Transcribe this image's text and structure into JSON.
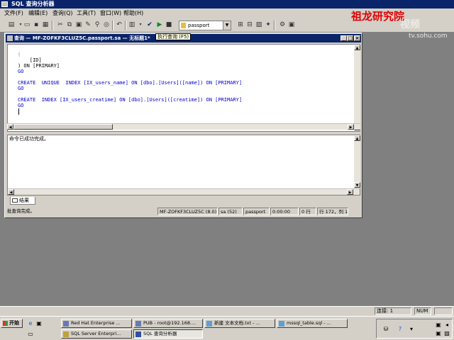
{
  "app": {
    "title": "SQL 查询分析器"
  },
  "watermark": {
    "cn": "祖龙研究院",
    "video": "视频",
    "site": "tv.sohu.com"
  },
  "menu": [
    "文件(F)",
    "编辑(E)",
    "查询(Q)",
    "工具(T)",
    "窗口(W)",
    "帮助(H)"
  ],
  "toolbar": {
    "database": "passport",
    "tooltip": "执行查询 (F5)",
    "icons": [
      "new-query-icon",
      "open-icon",
      "save-icon",
      "load-icon",
      "cut-icon",
      "copy-icon",
      "paste-icon",
      "clear-icon",
      "find-icon",
      "undo-icon",
      "results-mode-icon",
      "parse-icon",
      "execute-icon",
      "stop-icon",
      "object-browser-icon",
      "object-search-icon",
      "plan-icon",
      "options-icon"
    ]
  },
  "query_window": {
    "title": "查询 — MF-ZOFKF3CLUZ5C.passport.sa — 无标题1*",
    "code_lines": [
      "(",
      "    [ID]",
      ") ON [PRIMARY]",
      "GO",
      "",
      "CREATE  UNIQUE  INDEX [IX_users_name] ON [dbo].[Users]([name]) ON [PRIMARY]",
      "GO",
      "",
      "CREATE  INDEX [IX_users_creatime] ON [dbo].[Users]([creatime]) ON [PRIMARY]",
      "GO"
    ],
    "result_message": "命令已成功完成。",
    "tab_label": "结果",
    "status": {
      "message": "批查询完成。",
      "server": "MF-ZOFKF3CLUZ5C (8.0)",
      "user": "sa (52)",
      "database": "passport",
      "time": "0:00:00",
      "rows": "0 行",
      "position": "行 172，列 1"
    }
  },
  "app_status": {
    "connections": "连接: 1",
    "numlock": "NUM"
  },
  "taskbar": {
    "start": "开始",
    "tasks_row1": [
      "Red Hat Enterprise ...",
      "PUB - root@192.168....",
      "新建 文本文档.txt - ...",
      "mssql_table.sql - ..."
    ],
    "tasks_row2": [
      "SQL Server Enterpri...",
      "SQL 查询分析器"
    ]
  },
  "colors": {
    "title_active": "#0a246a",
    "face": "#d4d0c8",
    "keyword": "#0000cc",
    "watermark": "#e00000"
  }
}
